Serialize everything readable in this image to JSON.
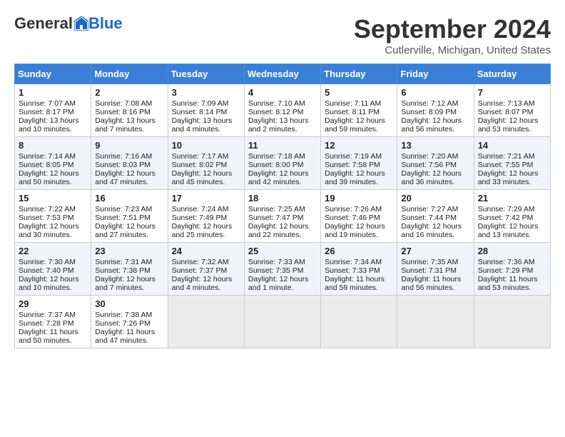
{
  "header": {
    "logo_general": "General",
    "logo_blue": "Blue",
    "month_title": "September 2024",
    "location": "Cutlerville, Michigan, United States"
  },
  "weekdays": [
    "Sunday",
    "Monday",
    "Tuesday",
    "Wednesday",
    "Thursday",
    "Friday",
    "Saturday"
  ],
  "weeks": [
    [
      {
        "day": "1",
        "sunrise": "Sunrise: 7:07 AM",
        "sunset": "Sunset: 8:17 PM",
        "daylight": "Daylight: 13 hours and 10 minutes."
      },
      {
        "day": "2",
        "sunrise": "Sunrise: 7:08 AM",
        "sunset": "Sunset: 8:16 PM",
        "daylight": "Daylight: 13 hours and 7 minutes."
      },
      {
        "day": "3",
        "sunrise": "Sunrise: 7:09 AM",
        "sunset": "Sunset: 8:14 PM",
        "daylight": "Daylight: 13 hours and 4 minutes."
      },
      {
        "day": "4",
        "sunrise": "Sunrise: 7:10 AM",
        "sunset": "Sunset: 8:12 PM",
        "daylight": "Daylight: 13 hours and 2 minutes."
      },
      {
        "day": "5",
        "sunrise": "Sunrise: 7:11 AM",
        "sunset": "Sunset: 8:11 PM",
        "daylight": "Daylight: 12 hours and 59 minutes."
      },
      {
        "day": "6",
        "sunrise": "Sunrise: 7:12 AM",
        "sunset": "Sunset: 8:09 PM",
        "daylight": "Daylight: 12 hours and 56 minutes."
      },
      {
        "day": "7",
        "sunrise": "Sunrise: 7:13 AM",
        "sunset": "Sunset: 8:07 PM",
        "daylight": "Daylight: 12 hours and 53 minutes."
      }
    ],
    [
      {
        "day": "8",
        "sunrise": "Sunrise: 7:14 AM",
        "sunset": "Sunset: 8:05 PM",
        "daylight": "Daylight: 12 hours and 50 minutes."
      },
      {
        "day": "9",
        "sunrise": "Sunrise: 7:16 AM",
        "sunset": "Sunset: 8:03 PM",
        "daylight": "Daylight: 12 hours and 47 minutes."
      },
      {
        "day": "10",
        "sunrise": "Sunrise: 7:17 AM",
        "sunset": "Sunset: 8:02 PM",
        "daylight": "Daylight: 12 hours and 45 minutes."
      },
      {
        "day": "11",
        "sunrise": "Sunrise: 7:18 AM",
        "sunset": "Sunset: 8:00 PM",
        "daylight": "Daylight: 12 hours and 42 minutes."
      },
      {
        "day": "12",
        "sunrise": "Sunrise: 7:19 AM",
        "sunset": "Sunset: 7:58 PM",
        "daylight": "Daylight: 12 hours and 39 minutes."
      },
      {
        "day": "13",
        "sunrise": "Sunrise: 7:20 AM",
        "sunset": "Sunset: 7:56 PM",
        "daylight": "Daylight: 12 hours and 36 minutes."
      },
      {
        "day": "14",
        "sunrise": "Sunrise: 7:21 AM",
        "sunset": "Sunset: 7:55 PM",
        "daylight": "Daylight: 12 hours and 33 minutes."
      }
    ],
    [
      {
        "day": "15",
        "sunrise": "Sunrise: 7:22 AM",
        "sunset": "Sunset: 7:53 PM",
        "daylight": "Daylight: 12 hours and 30 minutes."
      },
      {
        "day": "16",
        "sunrise": "Sunrise: 7:23 AM",
        "sunset": "Sunset: 7:51 PM",
        "daylight": "Daylight: 12 hours and 27 minutes."
      },
      {
        "day": "17",
        "sunrise": "Sunrise: 7:24 AM",
        "sunset": "Sunset: 7:49 PM",
        "daylight": "Daylight: 12 hours and 25 minutes."
      },
      {
        "day": "18",
        "sunrise": "Sunrise: 7:25 AM",
        "sunset": "Sunset: 7:47 PM",
        "daylight": "Daylight: 12 hours and 22 minutes."
      },
      {
        "day": "19",
        "sunrise": "Sunrise: 7:26 AM",
        "sunset": "Sunset: 7:46 PM",
        "daylight": "Daylight: 12 hours and 19 minutes."
      },
      {
        "day": "20",
        "sunrise": "Sunrise: 7:27 AM",
        "sunset": "Sunset: 7:44 PM",
        "daylight": "Daylight: 12 hours and 16 minutes."
      },
      {
        "day": "21",
        "sunrise": "Sunrise: 7:29 AM",
        "sunset": "Sunset: 7:42 PM",
        "daylight": "Daylight: 12 hours and 13 minutes."
      }
    ],
    [
      {
        "day": "22",
        "sunrise": "Sunrise: 7:30 AM",
        "sunset": "Sunset: 7:40 PM",
        "daylight": "Daylight: 12 hours and 10 minutes."
      },
      {
        "day": "23",
        "sunrise": "Sunrise: 7:31 AM",
        "sunset": "Sunset: 7:38 PM",
        "daylight": "Daylight: 12 hours and 7 minutes."
      },
      {
        "day": "24",
        "sunrise": "Sunrise: 7:32 AM",
        "sunset": "Sunset: 7:37 PM",
        "daylight": "Daylight: 12 hours and 4 minutes."
      },
      {
        "day": "25",
        "sunrise": "Sunrise: 7:33 AM",
        "sunset": "Sunset: 7:35 PM",
        "daylight": "Daylight: 12 hours and 1 minute."
      },
      {
        "day": "26",
        "sunrise": "Sunrise: 7:34 AM",
        "sunset": "Sunset: 7:33 PM",
        "daylight": "Daylight: 11 hours and 59 minutes."
      },
      {
        "day": "27",
        "sunrise": "Sunrise: 7:35 AM",
        "sunset": "Sunset: 7:31 PM",
        "daylight": "Daylight: 11 hours and 56 minutes."
      },
      {
        "day": "28",
        "sunrise": "Sunrise: 7:36 AM",
        "sunset": "Sunset: 7:29 PM",
        "daylight": "Daylight: 11 hours and 53 minutes."
      }
    ],
    [
      {
        "day": "29",
        "sunrise": "Sunrise: 7:37 AM",
        "sunset": "Sunset: 7:28 PM",
        "daylight": "Daylight: 11 hours and 50 minutes."
      },
      {
        "day": "30",
        "sunrise": "Sunrise: 7:38 AM",
        "sunset": "Sunset: 7:26 PM",
        "daylight": "Daylight: 11 hours and 47 minutes."
      },
      null,
      null,
      null,
      null,
      null
    ]
  ]
}
